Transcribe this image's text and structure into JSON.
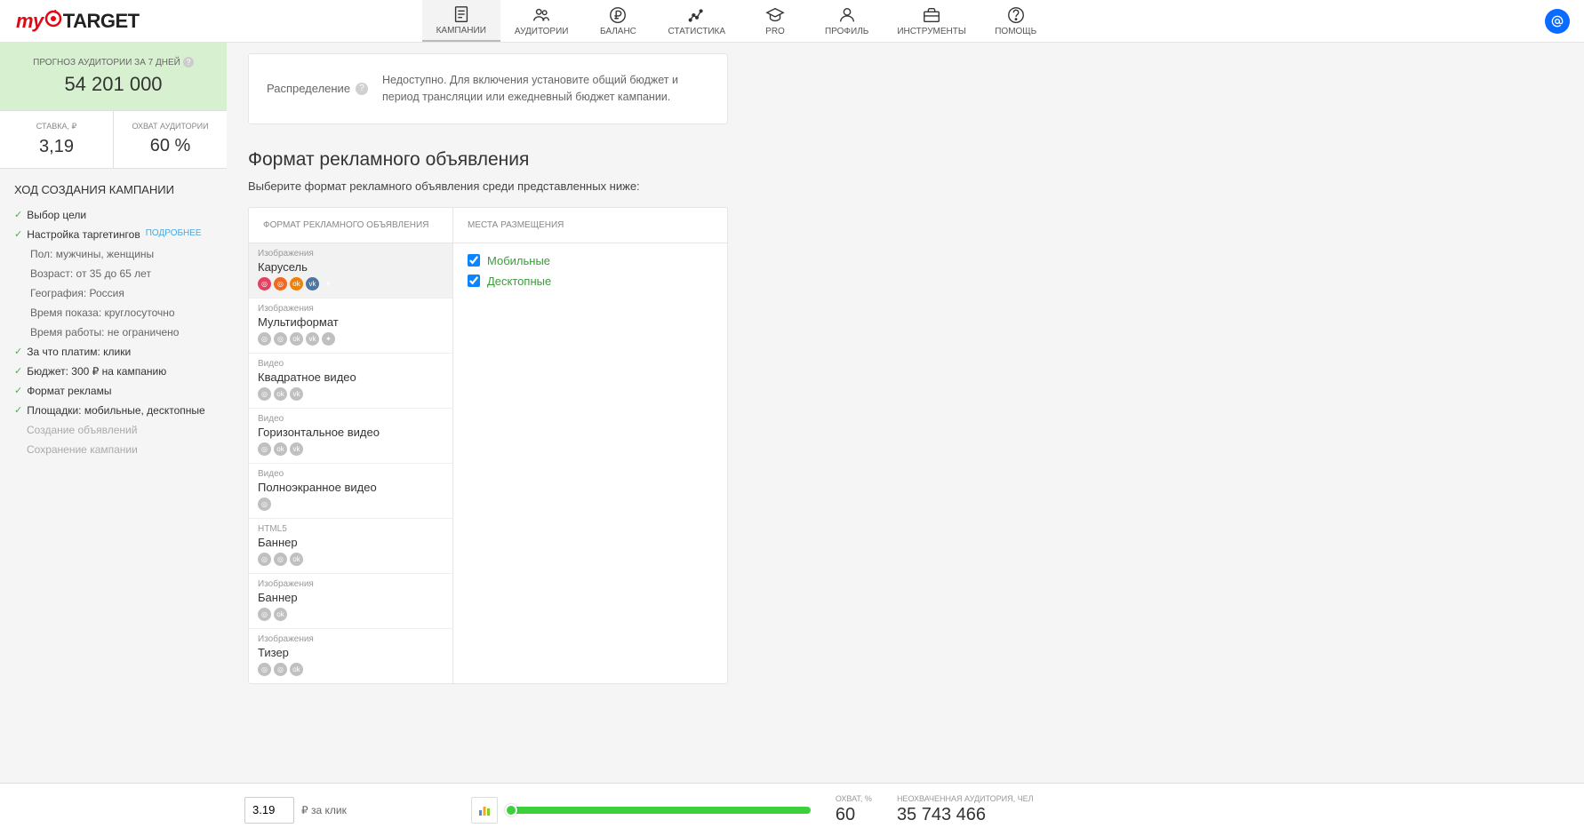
{
  "logo": {
    "my": "my",
    "target": "TARGET"
  },
  "nav": {
    "items": [
      {
        "label": "КАМПАНИИ"
      },
      {
        "label": "АУДИТОРИИ"
      },
      {
        "label": "БАЛАНС"
      },
      {
        "label": "СТАТИСТИКА"
      },
      {
        "label": "PRO"
      },
      {
        "label": "ПРОФИЛЬ"
      },
      {
        "label": "ИНСТРУМЕНТЫ"
      },
      {
        "label": "ПОМОЩЬ"
      }
    ]
  },
  "sidebar": {
    "forecast_label": "ПРОГНОЗ АУДИТОРИИ ЗА 7 ДНЕЙ",
    "forecast_value": "54 201 000",
    "metric_bid_label": "СТАВКА, ₽",
    "metric_bid_value": "3,19",
    "metric_reach_label": "ОХВАТ АУДИТОРИИ",
    "metric_reach_value": "60 %",
    "progress_title": "ХОД СОЗДАНИЯ КАМПАНИИ",
    "steps": {
      "goal": "Выбор цели",
      "targeting": "Настройка таргетингов",
      "more": "ПОДРОБНЕЕ",
      "gender": "Пол: мужчины, женщины",
      "age": "Возраст: от 35 до 65 лет",
      "geo": "География: Россия",
      "time": "Время показа: круглосуточно",
      "duration": "Время работы: не ограничено",
      "payment": "За что платим: клики",
      "budget": "Бюджет: 300 ₽ на кампанию",
      "format": "Формат рекламы",
      "placements": "Площадки: мобильные, десктопные",
      "create_ads": "Создание объявлений",
      "save": "Сохранение кампании"
    }
  },
  "main": {
    "distribution_label": "Распределение",
    "distribution_text": "Недоступно. Для включения установите общий бюджет и период трансляции или ежедневный бюджет кампании.",
    "section_title": "Формат рекламного объявления",
    "section_sub": "Выберите формат рекламного объявления среди представленных ниже:",
    "col_format": "ФОРМАТ РЕКЛАМНОГО ОБЪЯВЛЕНИЯ",
    "col_placement": "МЕСТА РАЗМЕЩЕНИЯ",
    "formats": [
      {
        "type": "Изображения",
        "name": "Карусель"
      },
      {
        "type": "Изображения",
        "name": "Мультиформат"
      },
      {
        "type": "Видео",
        "name": "Квадратное видео"
      },
      {
        "type": "Видео",
        "name": "Горизонтальное видео"
      },
      {
        "type": "Видео",
        "name": "Полноэкранное видео"
      },
      {
        "type": "HTML5",
        "name": "Баннер"
      },
      {
        "type": "Изображения",
        "name": "Баннер"
      },
      {
        "type": "Изображения",
        "name": "Тизер"
      }
    ],
    "placements": {
      "mobile": "Мобильные",
      "desktop": "Десктопные"
    }
  },
  "bottom": {
    "bid_value": "3.19",
    "bid_label": "₽ за клик",
    "reach_label": "ОХВАТ, %",
    "reach_value": "60",
    "unreached_label": "НЕОХВАЧЕННАЯ АУДИТОРИЯ, ЧЕЛ",
    "unreached_value": "35 743 466"
  }
}
